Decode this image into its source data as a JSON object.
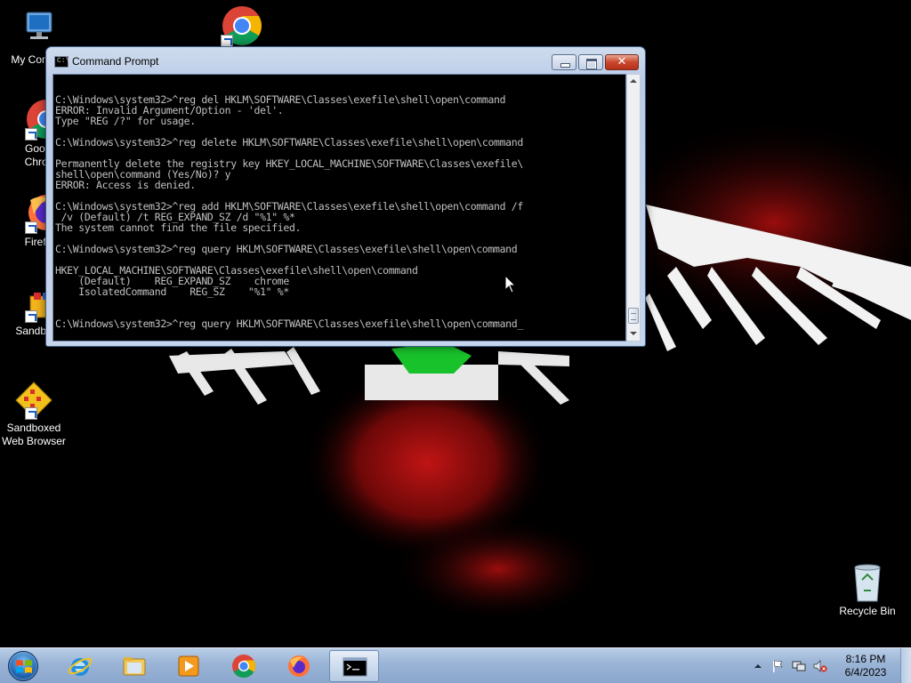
{
  "window": {
    "title": "Command Prompt",
    "icon": "cmd-icon",
    "minimize_icon": "minimize-icon",
    "maximize_icon": "maximize-icon",
    "close_icon": "close-icon",
    "close_glyph": "✕"
  },
  "console": {
    "text_color": "#c0c0c0",
    "background": "#000000",
    "lines": [
      "C:\\Windows\\system32>^reg del HKLM\\SOFTWARE\\Classes\\exefile\\shell\\open\\command",
      "ERROR: Invalid Argument/Option - 'del'.",
      "Type \"REG /?\" for usage.",
      "",
      "C:\\Windows\\system32>^reg delete HKLM\\SOFTWARE\\Classes\\exefile\\shell\\open\\command",
      "",
      "Permanently delete the registry key HKEY_LOCAL_MACHINE\\SOFTWARE\\Classes\\exefile\\",
      "shell\\open\\command (Yes/No)? y",
      "ERROR: Access is denied.",
      "",
      "C:\\Windows\\system32>^reg add HKLM\\SOFTWARE\\Classes\\exefile\\shell\\open\\command /f",
      " /v (Default) /t REG_EXPAND_SZ /d \"%1\" %*",
      "The system cannot find the file specified.",
      "",
      "C:\\Windows\\system32>^reg query HKLM\\SOFTWARE\\Classes\\exefile\\shell\\open\\command",
      "",
      "HKEY_LOCAL_MACHINE\\SOFTWARE\\Classes\\exefile\\shell\\open\\command",
      "    (Default)    REG_EXPAND_SZ    chrome",
      "    IsolatedCommand    REG_SZ    \"%1\" %*",
      "",
      "",
      "C:\\Windows\\system32>^reg query HKLM\\SOFTWARE\\Classes\\exefile\\shell\\open\\command_"
    ]
  },
  "desktop": {
    "icons": [
      {
        "label": "My Comp",
        "icon": "computer-icon"
      },
      {
        "label": "",
        "icon": "chrome-icon"
      },
      {
        "label": "Googl Chron",
        "icon": "chrome-icon"
      },
      {
        "label": "Firefo",
        "icon": "firefox-icon"
      },
      {
        "label": "Sandbox",
        "icon": "sandboxie-icon"
      },
      {
        "label": "Sandboxed Web Browser",
        "icon": "sandboxie-icon"
      },
      {
        "label": "Recycle Bin",
        "icon": "recycle-bin-icon"
      }
    ]
  },
  "taskbar": {
    "start_icon": "windows-start-icon",
    "pinned": [
      {
        "icon": "internet-explorer-icon"
      },
      {
        "icon": "file-explorer-icon"
      },
      {
        "icon": "media-player-icon"
      },
      {
        "icon": "chrome-icon"
      },
      {
        "icon": "firefox-icon"
      },
      {
        "icon": "cmd-icon",
        "active": true
      }
    ],
    "tray": [
      "show-hidden-icons-icon",
      "action-center-flag-icon",
      "network-icon",
      "volume-muted-icon"
    ],
    "time": "8:16 PM",
    "date": "6/4/2023"
  },
  "colors": {
    "taskbar": "#9ab4d6",
    "close_button": "#c9462c",
    "window_frame": "#b9cbe6"
  }
}
